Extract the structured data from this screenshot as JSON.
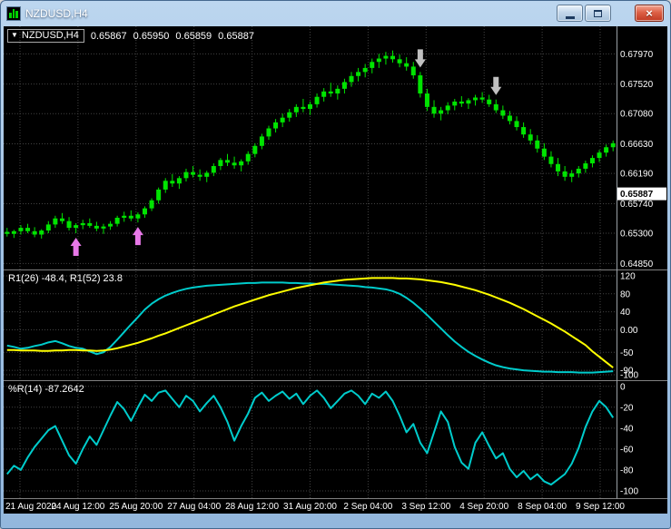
{
  "window": {
    "title": "NZDUSD,H4"
  },
  "icons": {
    "dropdown": "▼",
    "close_glyph": "×"
  },
  "chart": {
    "symbol_period": "NZDUSD,H4",
    "ohlc": {
      "open": "0.65867",
      "high": "0.65950",
      "low": "0.65859",
      "close": "0.65887"
    },
    "indicators": {
      "r1_label": "R1(26) -48.4, R1(52) 23.8",
      "wpr_label": "%R(14) -87.2642"
    }
  },
  "colors": {
    "background": "#000000",
    "candle": "#00E400",
    "grid": "#434343",
    "divider": "#808080",
    "separator": "#9aa0a6",
    "up_arrow": "#E878E8",
    "down_arrow": "#C0C0C0",
    "axis_text": "#FFFFFF",
    "current_price_bg": "#FFFFFF",
    "line_cyan": "#00CCCC",
    "line_yellow": "#FFFF00"
  },
  "chart_data": [
    {
      "type": "candlestick",
      "title": "NZDUSD,H4",
      "y_range": [
        0.6476,
        0.6838
      ],
      "price_axis": [
        {
          "v": 0.6797,
          "t": "0.67970"
        },
        {
          "v": 0.6752,
          "t": "0.67520"
        },
        {
          "v": 0.6708,
          "t": "0.67080"
        },
        {
          "v": 0.6663,
          "t": "0.66630"
        },
        {
          "v": 0.6619,
          "t": "0.66190"
        },
        {
          "v": 0.6574,
          "t": "0.65740"
        },
        {
          "v": 0.653,
          "t": "0.65300"
        },
        {
          "v": 0.6485,
          "t": "0.64850"
        }
      ],
      "current_price": {
        "v": 0.65887,
        "t": "0.65887"
      },
      "x_labels": [
        "21 Aug 2020",
        "24 Aug 12:00",
        "25 Aug 20:00",
        "27 Aug 04:00",
        "28 Aug 12:00",
        "31 Aug 20:00",
        "2 Sep 04:00",
        "3 Sep 12:00",
        "4 Sep 20:00",
        "8 Sep 04:00",
        "9 Sep 12:00"
      ],
      "signals": {
        "up_arrows": [
          10,
          19
        ],
        "down_arrows": [
          60,
          71
        ]
      },
      "candles": [
        [
          0.6532,
          0.6538,
          0.6525,
          0.6529
        ],
        [
          0.6529,
          0.6535,
          0.6523,
          0.6533
        ],
        [
          0.6533,
          0.6542,
          0.6528,
          0.6538
        ],
        [
          0.6538,
          0.6544,
          0.653,
          0.6533
        ],
        [
          0.6533,
          0.6539,
          0.6524,
          0.6528
        ],
        [
          0.6528,
          0.6536,
          0.6522,
          0.6534
        ],
        [
          0.6534,
          0.6548,
          0.653,
          0.6543
        ],
        [
          0.6543,
          0.6556,
          0.6538,
          0.6552
        ],
        [
          0.6552,
          0.656,
          0.6544,
          0.6548
        ],
        [
          0.6548,
          0.6554,
          0.6534,
          0.6538
        ],
        [
          0.6538,
          0.6545,
          0.653,
          0.6542
        ],
        [
          0.6542,
          0.655,
          0.6536,
          0.6545
        ],
        [
          0.6545,
          0.6552,
          0.6538,
          0.6541
        ],
        [
          0.6541,
          0.6547,
          0.6533,
          0.6537
        ],
        [
          0.6537,
          0.6544,
          0.6529,
          0.654
        ],
        [
          0.654,
          0.6548,
          0.6535,
          0.6544
        ],
        [
          0.6544,
          0.6556,
          0.654,
          0.6553
        ],
        [
          0.6553,
          0.6562,
          0.6547,
          0.6556
        ],
        [
          0.6556,
          0.6564,
          0.6548,
          0.6552
        ],
        [
          0.6552,
          0.6561,
          0.6546,
          0.6558
        ],
        [
          0.6558,
          0.657,
          0.6553,
          0.6567
        ],
        [
          0.6567,
          0.6582,
          0.6563,
          0.6579
        ],
        [
          0.6579,
          0.6598,
          0.6574,
          0.6595
        ],
        [
          0.6595,
          0.6612,
          0.659,
          0.6608
        ],
        [
          0.6608,
          0.6618,
          0.6599,
          0.6604
        ],
        [
          0.6604,
          0.6615,
          0.6596,
          0.6612
        ],
        [
          0.6612,
          0.6626,
          0.6607,
          0.6621
        ],
        [
          0.6621,
          0.663,
          0.6613,
          0.6617
        ],
        [
          0.6617,
          0.6625,
          0.6608,
          0.6614
        ],
        [
          0.6614,
          0.6623,
          0.6606,
          0.662
        ],
        [
          0.662,
          0.6634,
          0.6615,
          0.663
        ],
        [
          0.663,
          0.6642,
          0.6624,
          0.6639
        ],
        [
          0.6639,
          0.6648,
          0.663,
          0.6635
        ],
        [
          0.6635,
          0.6644,
          0.6626,
          0.6631
        ],
        [
          0.6631,
          0.664,
          0.6622,
          0.6637
        ],
        [
          0.6637,
          0.6652,
          0.6632,
          0.6648
        ],
        [
          0.6648,
          0.6664,
          0.6643,
          0.666
        ],
        [
          0.666,
          0.6678,
          0.6655,
          0.6674
        ],
        [
          0.6674,
          0.669,
          0.6669,
          0.6686
        ],
        [
          0.6686,
          0.67,
          0.668,
          0.6695
        ],
        [
          0.6695,
          0.6708,
          0.6688,
          0.6702
        ],
        [
          0.6702,
          0.6715,
          0.6696,
          0.671
        ],
        [
          0.671,
          0.6722,
          0.6703,
          0.6718
        ],
        [
          0.6718,
          0.673,
          0.671,
          0.6715
        ],
        [
          0.6715,
          0.6726,
          0.6706,
          0.6722
        ],
        [
          0.6722,
          0.6738,
          0.6717,
          0.6733
        ],
        [
          0.6733,
          0.6746,
          0.6726,
          0.6741
        ],
        [
          0.6741,
          0.6754,
          0.6733,
          0.6738
        ],
        [
          0.6738,
          0.675,
          0.6729,
          0.6745
        ],
        [
          0.6745,
          0.676,
          0.6738,
          0.6755
        ],
        [
          0.6755,
          0.677,
          0.6748,
          0.6764
        ],
        [
          0.6764,
          0.6776,
          0.6756,
          0.677
        ],
        [
          0.677,
          0.6782,
          0.6762,
          0.6776
        ],
        [
          0.6776,
          0.679,
          0.6768,
          0.6785
        ],
        [
          0.6785,
          0.6797,
          0.6776,
          0.679
        ],
        [
          0.679,
          0.68,
          0.6781,
          0.6794
        ],
        [
          0.6794,
          0.6802,
          0.6784,
          0.6789
        ],
        [
          0.6789,
          0.6796,
          0.6777,
          0.6783
        ],
        [
          0.6783,
          0.6792,
          0.6772,
          0.6778
        ],
        [
          0.6778,
          0.6785,
          0.676,
          0.6765
        ],
        [
          0.6765,
          0.677,
          0.6732,
          0.6738
        ],
        [
          0.6738,
          0.6745,
          0.6712,
          0.6718
        ],
        [
          0.6718,
          0.6728,
          0.6702,
          0.6708
        ],
        [
          0.6708,
          0.6718,
          0.6698,
          0.6713
        ],
        [
          0.6713,
          0.6725,
          0.6707,
          0.672
        ],
        [
          0.672,
          0.673,
          0.6713,
          0.6726
        ],
        [
          0.6726,
          0.6734,
          0.6718,
          0.6723
        ],
        [
          0.6723,
          0.6731,
          0.6715,
          0.6728
        ],
        [
          0.6728,
          0.6736,
          0.672,
          0.6732
        ],
        [
          0.6732,
          0.674,
          0.6724,
          0.6729
        ],
        [
          0.6729,
          0.6736,
          0.6718,
          0.6722
        ],
        [
          0.6722,
          0.6729,
          0.6709,
          0.6713
        ],
        [
          0.6713,
          0.672,
          0.67,
          0.6705
        ],
        [
          0.6705,
          0.6712,
          0.6692,
          0.6697
        ],
        [
          0.6697,
          0.6704,
          0.6683,
          0.6688
        ],
        [
          0.6688,
          0.6695,
          0.6672,
          0.6677
        ],
        [
          0.6677,
          0.6685,
          0.6662,
          0.6668
        ],
        [
          0.6668,
          0.6676,
          0.665,
          0.6656
        ],
        [
          0.6656,
          0.6664,
          0.6639,
          0.6644
        ],
        [
          0.6644,
          0.6652,
          0.6628,
          0.6633
        ],
        [
          0.6633,
          0.6642,
          0.6615,
          0.6622
        ],
        [
          0.6622,
          0.663,
          0.6608,
          0.6614
        ],
        [
          0.6614,
          0.6624,
          0.6606,
          0.6619
        ],
        [
          0.6619,
          0.663,
          0.6613,
          0.6626
        ],
        [
          0.6626,
          0.6638,
          0.662,
          0.6634
        ],
        [
          0.6634,
          0.6646,
          0.6628,
          0.6642
        ],
        [
          0.6642,
          0.6654,
          0.6636,
          0.665
        ],
        [
          0.665,
          0.6662,
          0.6644,
          0.6658
        ],
        [
          0.6658,
          0.6668,
          0.6652,
          0.6664
        ]
      ]
    },
    {
      "type": "line",
      "title": "R1 oscillator",
      "label": "R1(26) -48.4, R1(52) 23.8",
      "y_range": [
        -112,
        132
      ],
      "scale": [
        {
          "v": 120,
          "t": "120"
        },
        {
          "v": 80,
          "t": "80"
        },
        {
          "v": 40,
          "t": "40"
        },
        {
          "v": 0,
          "t": "0.00"
        },
        {
          "v": -50,
          "t": "-50"
        },
        {
          "v": -90,
          "t": "-90"
        },
        {
          "v": -100,
          "t": "-100"
        }
      ],
      "series": [
        {
          "name": "R1(26)",
          "color": "#00CCCC",
          "values": [
            -35,
            -38,
            -42,
            -40,
            -36,
            -33,
            -28,
            -25,
            -30,
            -36,
            -40,
            -42,
            -48,
            -54,
            -50,
            -38,
            -22,
            -5,
            12,
            28,
            45,
            58,
            68,
            76,
            82,
            87,
            91,
            94,
            96,
            98,
            99,
            100,
            101,
            102,
            103,
            104,
            104,
            105,
            105,
            105,
            105,
            104,
            104,
            103,
            103,
            102,
            102,
            101,
            100,
            99,
            98,
            97,
            95,
            94,
            92,
            90,
            86,
            80,
            71,
            60,
            47,
            33,
            18,
            3,
            -12,
            -26,
            -38,
            -49,
            -58,
            -66,
            -73,
            -79,
            -83,
            -86,
            -88,
            -90,
            -91,
            -92,
            -93,
            -93,
            -94,
            -94,
            -94,
            -95,
            -95,
            -95,
            -94,
            -93,
            -92
          ]
        },
        {
          "name": "R1(52)",
          "color": "#FFFF00",
          "values": [
            -45,
            -45,
            -46,
            -46,
            -46,
            -47,
            -47,
            -46,
            -46,
            -45,
            -45,
            -46,
            -46,
            -47,
            -46,
            -44,
            -41,
            -37,
            -33,
            -29,
            -24,
            -19,
            -13,
            -8,
            -2,
            4,
            10,
            16,
            22,
            28,
            34,
            40,
            46,
            52,
            57,
            62,
            67,
            72,
            77,
            81,
            85,
            89,
            93,
            96,
            99,
            102,
            105,
            107,
            109,
            111,
            112,
            113,
            114,
            115,
            115,
            115,
            115,
            114,
            114,
            113,
            112,
            110,
            108,
            106,
            103,
            100,
            96,
            92,
            88,
            83,
            78,
            72,
            66,
            60,
            53,
            46,
            38,
            30,
            22,
            14,
            5,
            -4,
            -14,
            -24,
            -34,
            -48,
            -60,
            -72,
            -84
          ]
        }
      ]
    },
    {
      "type": "line",
      "title": "Williams Percent Range",
      "label": "%R(14) -87.2642",
      "y_range": [
        -107,
        5
      ],
      "scale": [
        {
          "v": 0,
          "t": "0"
        },
        {
          "v": -20,
          "t": "-20"
        },
        {
          "v": -40,
          "t": "-40"
        },
        {
          "v": -60,
          "t": "-60"
        },
        {
          "v": -80,
          "t": "-80"
        },
        {
          "v": -100,
          "t": "-100"
        }
      ],
      "series": [
        {
          "name": "%R(14)",
          "color": "#00CCCC",
          "values": [
            -84,
            -76,
            -80,
            -68,
            -58,
            -50,
            -42,
            -38,
            -52,
            -66,
            -74,
            -60,
            -48,
            -56,
            -42,
            -28,
            -15,
            -22,
            -33,
            -20,
            -8,
            -14,
            -6,
            -4,
            -12,
            -20,
            -9,
            -14,
            -24,
            -16,
            -9,
            -20,
            -34,
            -52,
            -38,
            -26,
            -11,
            -6,
            -14,
            -9,
            -5,
            -12,
            -7,
            -17,
            -9,
            -4,
            -11,
            -21,
            -14,
            -7,
            -4,
            -9,
            -17,
            -7,
            -11,
            -5,
            -14,
            -28,
            -44,
            -36,
            -54,
            -64,
            -44,
            -24,
            -34,
            -58,
            -73,
            -79,
            -54,
            -44,
            -57,
            -69,
            -64,
            -79,
            -87,
            -81,
            -89,
            -84,
            -91,
            -94,
            -89,
            -84,
            -74,
            -59,
            -39,
            -24,
            -14,
            -20,
            -30
          ]
        }
      ]
    }
  ]
}
